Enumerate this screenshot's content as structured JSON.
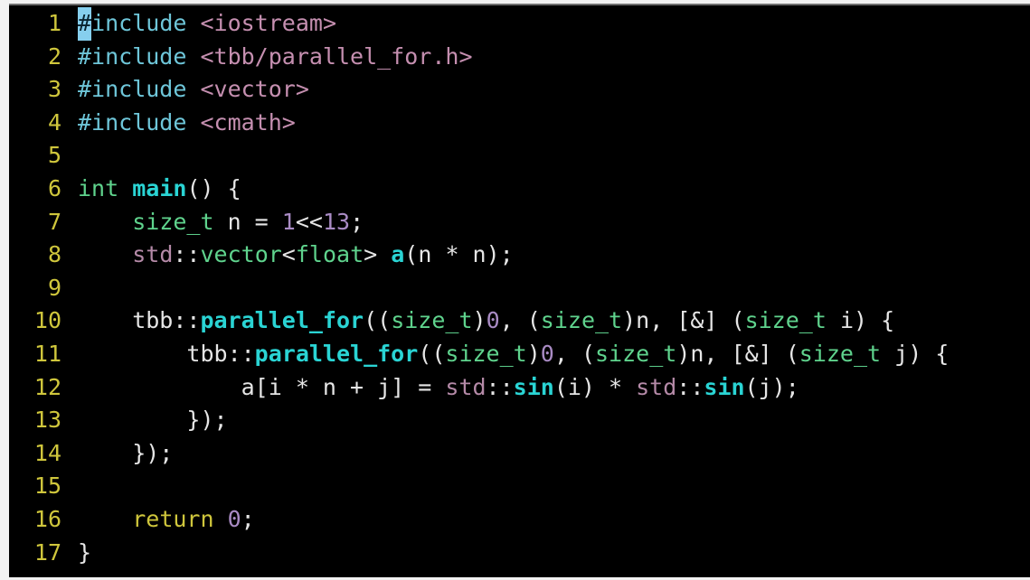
{
  "editor": {
    "language": "cpp",
    "theme": "dark",
    "background": "#000000",
    "gutter_color": "#cfc63c",
    "cursor": {
      "line": 1,
      "column": 1,
      "color": "#86cfee",
      "glyph_color": "#08222e"
    },
    "first_visible_line": 1,
    "last_visible_line": 17,
    "colors": {
      "plain": "#e6e6e6",
      "preprocessor": "#6ec6d9",
      "include_path": "#c58fb0",
      "type": "#5fd38d",
      "keyword": "#cfc63c",
      "function": "#2ad4d4",
      "number": "#a98bc4",
      "namespace": "#b58aa8",
      "variable": "#2ad4d4"
    },
    "lines": [
      {
        "number": "1",
        "tokens": [
          {
            "text": "#",
            "cls": "t-preproc cursor"
          },
          {
            "text": "include ",
            "cls": "t-preproc"
          },
          {
            "text": "<iostream>",
            "cls": "t-string"
          }
        ]
      },
      {
        "number": "2",
        "tokens": [
          {
            "text": "#include ",
            "cls": "t-preproc"
          },
          {
            "text": "<tbb/parallel_for.h>",
            "cls": "t-string"
          }
        ]
      },
      {
        "number": "3",
        "tokens": [
          {
            "text": "#include ",
            "cls": "t-preproc"
          },
          {
            "text": "<vector>",
            "cls": "t-string"
          }
        ]
      },
      {
        "number": "4",
        "tokens": [
          {
            "text": "#include ",
            "cls": "t-preproc"
          },
          {
            "text": "<cmath>",
            "cls": "t-string"
          }
        ]
      },
      {
        "number": "5",
        "tokens": []
      },
      {
        "number": "6",
        "tokens": [
          {
            "text": "int ",
            "cls": "t-type"
          },
          {
            "text": "main",
            "cls": "t-func"
          },
          {
            "text": "() {",
            "cls": "t-plain"
          }
        ]
      },
      {
        "number": "7",
        "tokens": [
          {
            "text": "    ",
            "cls": "t-plain"
          },
          {
            "text": "size_t",
            "cls": "t-type"
          },
          {
            "text": " n = ",
            "cls": "t-plain"
          },
          {
            "text": "1",
            "cls": "t-number"
          },
          {
            "text": "<<",
            "cls": "t-plain"
          },
          {
            "text": "13",
            "cls": "t-number"
          },
          {
            "text": ";",
            "cls": "t-plain"
          }
        ]
      },
      {
        "number": "8",
        "tokens": [
          {
            "text": "    ",
            "cls": "t-plain"
          },
          {
            "text": "std",
            "cls": "t-ns"
          },
          {
            "text": "::",
            "cls": "t-plain"
          },
          {
            "text": "vector",
            "cls": "t-type"
          },
          {
            "text": "<",
            "cls": "t-plain"
          },
          {
            "text": "float",
            "cls": "t-type"
          },
          {
            "text": "> ",
            "cls": "t-plain"
          },
          {
            "text": "a",
            "cls": "t-var"
          },
          {
            "text": "(n * n);",
            "cls": "t-plain"
          }
        ]
      },
      {
        "number": "9",
        "tokens": []
      },
      {
        "number": "10",
        "tokens": [
          {
            "text": "    tbb::",
            "cls": "t-plain"
          },
          {
            "text": "parallel_for",
            "cls": "t-func"
          },
          {
            "text": "((",
            "cls": "t-plain"
          },
          {
            "text": "size_t",
            "cls": "t-type"
          },
          {
            "text": ")",
            "cls": "t-plain"
          },
          {
            "text": "0",
            "cls": "t-number"
          },
          {
            "text": ", (",
            "cls": "t-plain"
          },
          {
            "text": "size_t",
            "cls": "t-type"
          },
          {
            "text": ")n, [&] (",
            "cls": "t-plain"
          },
          {
            "text": "size_t",
            "cls": "t-type"
          },
          {
            "text": " i) {",
            "cls": "t-plain"
          }
        ]
      },
      {
        "number": "11",
        "tokens": [
          {
            "text": "        tbb::",
            "cls": "t-plain"
          },
          {
            "text": "parallel_for",
            "cls": "t-func"
          },
          {
            "text": "((",
            "cls": "t-plain"
          },
          {
            "text": "size_t",
            "cls": "t-type"
          },
          {
            "text": ")",
            "cls": "t-plain"
          },
          {
            "text": "0",
            "cls": "t-number"
          },
          {
            "text": ", (",
            "cls": "t-plain"
          },
          {
            "text": "size_t",
            "cls": "t-type"
          },
          {
            "text": ")n, [&] (",
            "cls": "t-plain"
          },
          {
            "text": "size_t",
            "cls": "t-type"
          },
          {
            "text": " j) {",
            "cls": "t-plain"
          }
        ]
      },
      {
        "number": "12",
        "tokens": [
          {
            "text": "            a[i * n + j] = ",
            "cls": "t-plain"
          },
          {
            "text": "std",
            "cls": "t-ns"
          },
          {
            "text": "::",
            "cls": "t-plain"
          },
          {
            "text": "sin",
            "cls": "t-func"
          },
          {
            "text": "(i) * ",
            "cls": "t-plain"
          },
          {
            "text": "std",
            "cls": "t-ns"
          },
          {
            "text": "::",
            "cls": "t-plain"
          },
          {
            "text": "sin",
            "cls": "t-func"
          },
          {
            "text": "(j);",
            "cls": "t-plain"
          }
        ]
      },
      {
        "number": "13",
        "tokens": [
          {
            "text": "        });",
            "cls": "t-plain"
          }
        ]
      },
      {
        "number": "14",
        "tokens": [
          {
            "text": "    });",
            "cls": "t-plain"
          }
        ]
      },
      {
        "number": "15",
        "tokens": []
      },
      {
        "number": "16",
        "tokens": [
          {
            "text": "    ",
            "cls": "t-plain"
          },
          {
            "text": "return",
            "cls": "t-keyword"
          },
          {
            "text": " ",
            "cls": "t-plain"
          },
          {
            "text": "0",
            "cls": "t-number"
          },
          {
            "text": ";",
            "cls": "t-plain"
          }
        ]
      },
      {
        "number": "17",
        "tokens": [
          {
            "text": "}",
            "cls": "t-plain"
          }
        ]
      }
    ]
  }
}
